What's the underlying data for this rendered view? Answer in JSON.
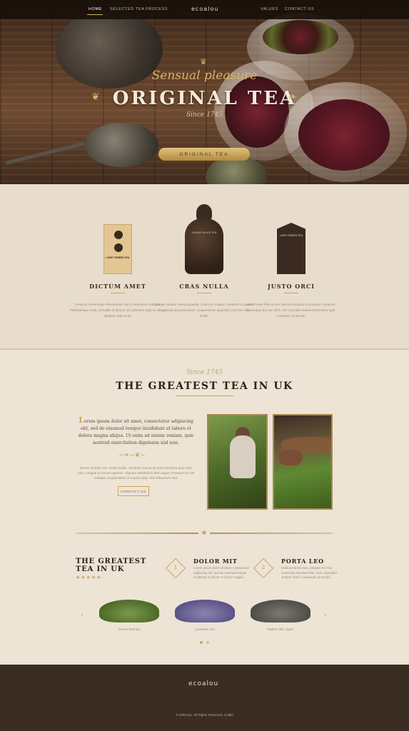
{
  "nav": {
    "items": [
      {
        "label": "HOME",
        "active": true
      },
      {
        "label": "SELECTED TEA",
        "active": false
      },
      {
        "label": "PROCESS",
        "active": false
      },
      {
        "label": "VALUES",
        "active": false
      },
      {
        "label": "CONTACT US",
        "active": false
      }
    ],
    "logo": "ecoalou"
  },
  "hero": {
    "script": "Sensual pleasure",
    "title": "ORIGINAL TEA",
    "since": "Since 1745",
    "button_label": "ORIGINAL TEA"
  },
  "products": [
    {
      "title": "DICTUM AMET",
      "package_label": "LIGHT GREEN TEA",
      "text": "Vivamus scelerisque felis pretium dui in bibendum volutpat. Pellentesque nulla, convallis et dictum vel, pharetra eget leo. Cras dapibus nulla amet."
    },
    {
      "title": "CRAS NULLA",
      "package_label": "UNIQUE BLACK TEA",
      "text": "Integer aliquet viverra gravida. Cras orci magna, hendrerit a sapien id, gravida placerat ipsum. Suspendisse dignissim nisi non nulla mollis."
    },
    {
      "title": "JUSTO ORCI",
      "package_label": "LIGHT GREEN TEA",
      "text": "Morbi vitae felis eu orci lacinia tincidunt ut ut ipsum. Vivamus consequat dui nec nibh, nec convallis massa fermentum eget. Curabitur commodo."
    }
  ],
  "about": {
    "since": "Since 1745",
    "title": "THE GREATEST TEA IN UK",
    "lead_initial": "L",
    "lead": "orem ipsum dolor sit amet, consectetur adipiscing elit, sed do eiusmod tempor incididunt ut labore et dolore magna aliqua. Ut enim ad minim veniam, quis nostrud exercitation dignissim nisl non.",
    "body": "Donec et dolor non. Nulla facilisi. Vivamus mauris sit amet pharetra quis nunc odio, congue ut ornare egestas. Aliquam vestibulum felis augue. Praesent at nisi volutpat. Suspendisse id mauris vitae. Nisi bibendum sed.",
    "contact_label": "CONTACT US"
  },
  "features": {
    "title": "THE GREATEST TEA IN UK",
    "stars": "★★★★★",
    "items": [
      {
        "num": "1",
        "title": "DOLOR MIT",
        "text": "Lorem ipsum dolor sit amet, consectetur adipiscing elit, sed do eiusmod tempor incididunt ut labore et dolore magna."
      },
      {
        "num": "2",
        "title": "PORTA LEO",
        "text": "Nulla porta leo non, volutpat orci nisi, commodo tincidunt felis. Nunc imperdiet semper lorem consequat commodo."
      }
    ],
    "carousel": {
      "captions": [
        "Green leaf tea",
        "Lavender tea",
        "Rather title caput"
      ],
      "prev_icon": "chevron-left-icon",
      "next_icon": "chevron-right-icon"
    }
  },
  "footer": {
    "logo": "ecoalou",
    "copyright": "© 2090 tea. All Rights Reserved.",
    "brand": "Coldin"
  },
  "colors": {
    "accent": "#c9a35a",
    "dark": "#3b2d22",
    "background": "#ede4d6"
  }
}
